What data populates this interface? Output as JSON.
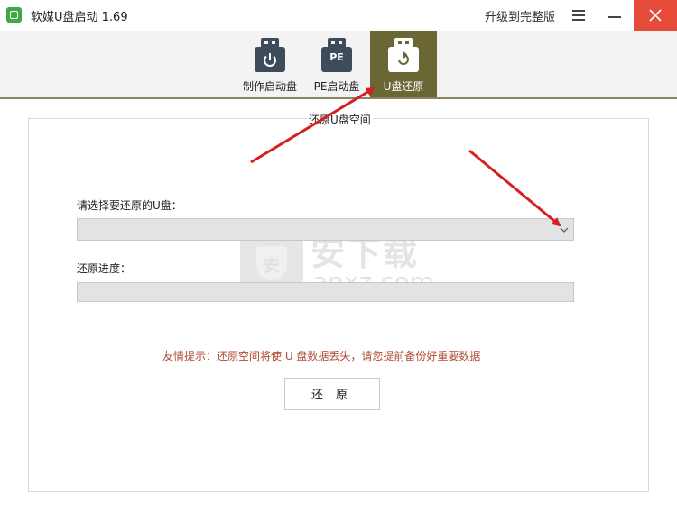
{
  "window": {
    "title": "软媒U盘启动 1.69",
    "upgrade_label": "升级到完整版",
    "icons": {
      "app": "usb-app-icon",
      "menu": "menu-icon",
      "minimize": "minimize-icon",
      "close": "close-icon"
    }
  },
  "toolbar": {
    "items": [
      {
        "label": "制作启动盘",
        "icon": "usb-power-icon",
        "active": false
      },
      {
        "label": "PE启动盘",
        "icon": "usb-pe-icon",
        "icon_text": "PE",
        "active": false
      },
      {
        "label": "U盘还原",
        "icon": "usb-restore-icon",
        "active": true
      }
    ]
  },
  "main": {
    "section_title": "还原U盘空间",
    "select_label": "请选择要还原的U盘：",
    "select_value": "",
    "progress_label": "还原进度：",
    "progress": 0,
    "tip": "友情提示：还原空间将使 U 盘数据丢失，请您提前备份好重要数据",
    "restore_button": "还原"
  },
  "watermark": {
    "shield_text": "安",
    "brand": "安下载",
    "domain": "anxz.com"
  },
  "colors": {
    "active_tab": "#6b6734",
    "icon_dark": "#3d4b5a",
    "close_button": "#e64b3c",
    "tip_text": "#b04a30",
    "arrow": "#d62020"
  }
}
